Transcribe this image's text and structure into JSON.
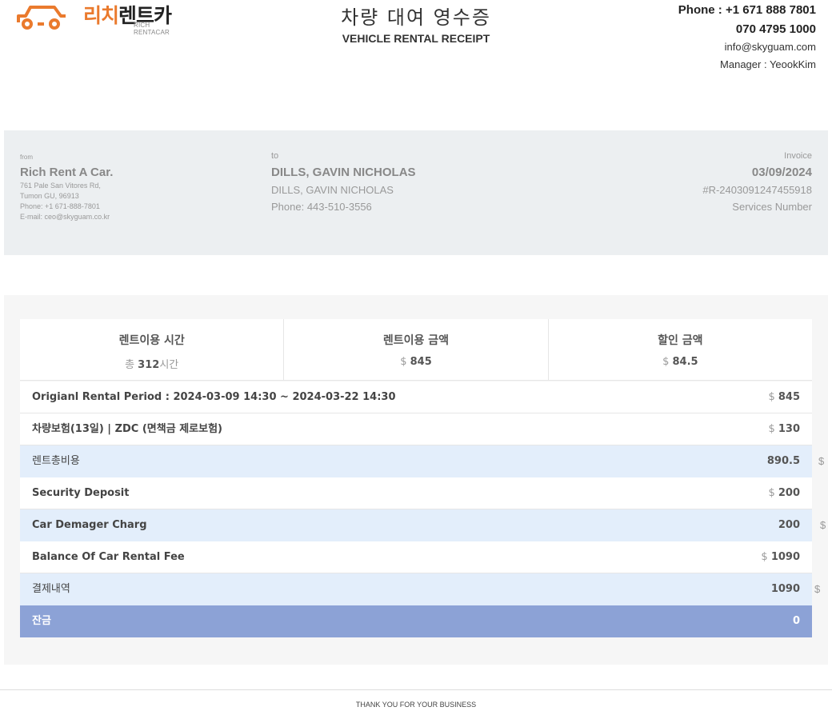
{
  "header": {
    "logo_text_orange": "리치",
    "logo_text_dark": "렌트카",
    "logo_sub": "RICH RENTACAR",
    "title_ko": "차량 대여 영수증",
    "title_en": "VEHICLE RENTAL RECEIPT",
    "phone1": "Phone : +1 671 888 7801",
    "phone2": "070 4795 1000",
    "email": "info@skyguam.com",
    "manager": "Manager : YeookKim"
  },
  "from": {
    "label": "from",
    "name": "Rich Rent A Car.",
    "address1": "761 Pale San Vitores Rd,",
    "address2": "Tumon GU, 96913",
    "phone": "Phone: +1 671-888-7801",
    "email": "E-mail: ceo@skyguam.co.kr"
  },
  "to": {
    "label": "to",
    "name": "DILLS, GAVIN NICHOLAS",
    "name2": "DILLS, GAVIN NICHOLAS",
    "phone": "Phone: 443-510-3556"
  },
  "invoice": {
    "label": "Invoice",
    "date": "03/09/2024",
    "number": "#R-2403091247455918",
    "services": "Services Number"
  },
  "summary": {
    "hours_head": "렌트이용 시간",
    "hours_prefix": "총 ",
    "hours_value": "312",
    "hours_suffix": "시간",
    "amount_head": "렌트이용 금액",
    "amount_prefix": "$ ",
    "amount_value": "845",
    "discount_head": "할인 금액",
    "discount_prefix": "$ ",
    "discount_value": "84.5"
  },
  "rows": {
    "period_label": "Origianl Rental Period : 2024-03-09 14:30 ~ 2024-03-22 14:30",
    "period_prefix": "$ ",
    "period_value": "845",
    "insurance_label": "차량보험(13일) | ZDC (면책금 제로보험)",
    "insurance_prefix": "$ ",
    "insurance_value": "130",
    "total_label": "렌트총비용",
    "total_value": "890.5",
    "total_suffix": "$",
    "deposit_label": "Security Deposit",
    "deposit_prefix": "$ ",
    "deposit_value": "200",
    "damage_label": "Car Demager Charg",
    "damage_value": "200",
    "damage_suffix": "$",
    "balance_label": "Balance Of Car Rental Fee",
    "balance_prefix": "$ ",
    "balance_value": "1090",
    "payment_label": "결제내역",
    "payment_value": "1090",
    "payment_suffix": "$",
    "remaining_label": "잔금",
    "remaining_value": "0"
  },
  "footer": {
    "text": "THANK YOU FOR YOUR BUSINESS"
  },
  "colors": {
    "logo_orange": "#ea7a2d",
    "info_band": "#eceff1",
    "highlight_row": "#e3eefb",
    "final_row": "#8ca2d6"
  }
}
